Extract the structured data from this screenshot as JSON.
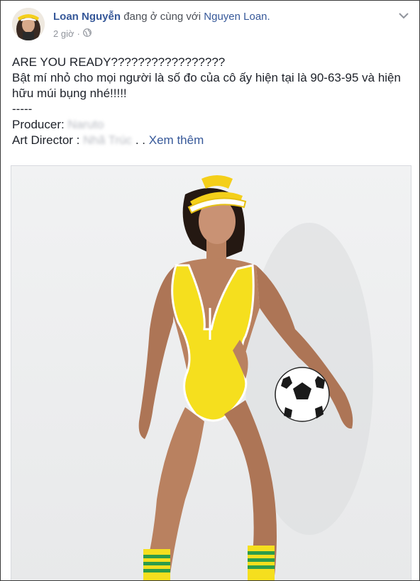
{
  "header": {
    "author": "Loan Nguyễn",
    "connector": "đang ở cùng với",
    "with_name": "Nguyen Loan.",
    "time": "2 giờ",
    "separator": "·",
    "privacy_icon": "globe-icon",
    "menu_icon": "chevron-down-icon"
  },
  "post": {
    "line1": "ARE YOU READY?????????????????",
    "line2": "Bật mí nhỏ cho mọi người là số đo của cô ấy hiện tại là 90-63-95 và hiện hữu múi bụng nhé!!!!!",
    "divider": "-----",
    "producer_label": "Producer:",
    "producer_name": "Naruto",
    "art_director_label": "Art Director :",
    "art_director_name": "Nhã Trúc",
    "ellipsis": ". .",
    "see_more": "Xem thêm"
  },
  "colors": {
    "link": "#365899",
    "swimsuit": "#f5df1e",
    "cap": "#f4cf1a",
    "sock_stripe": "#2d9c4a"
  }
}
